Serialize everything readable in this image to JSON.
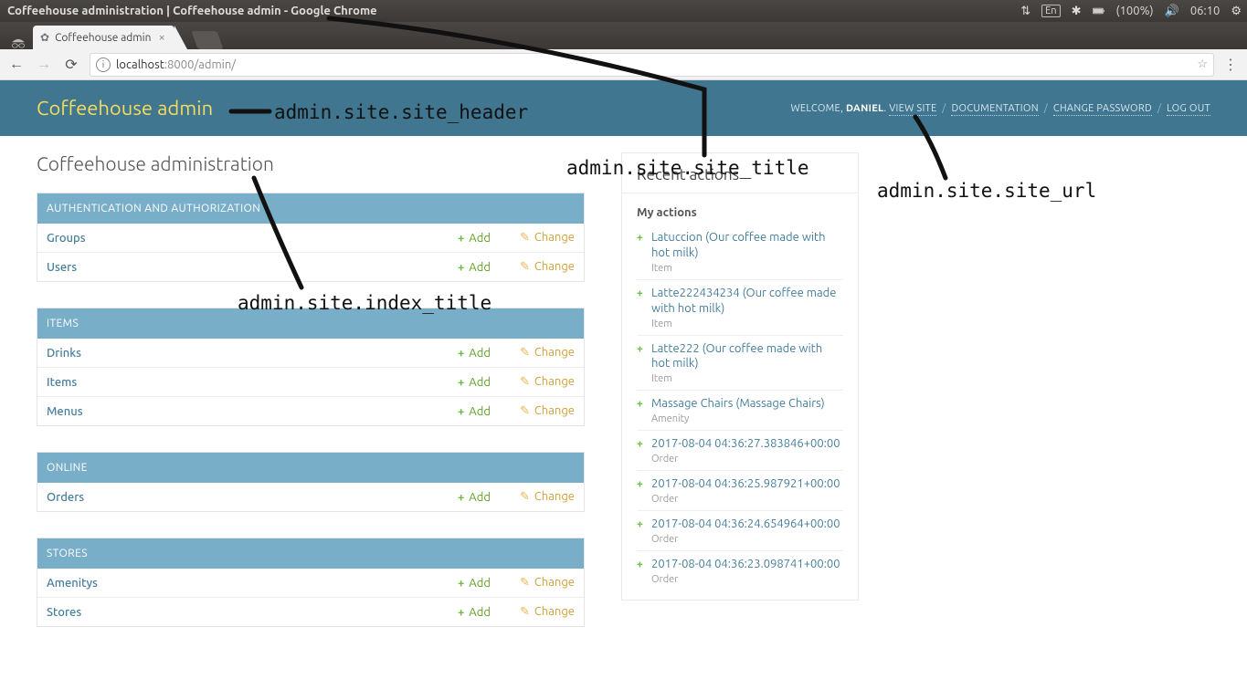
{
  "os": {
    "window_title": "Coffeehouse administration | Coffeehouse admin - Google Chrome",
    "lang": "En",
    "battery": "(100%)",
    "clock": "06:10"
  },
  "browser": {
    "tab_title": "Coffeehouse admin",
    "url_host": "localhost",
    "url_port": ":8000",
    "url_path": "/admin/"
  },
  "header": {
    "brand": "Coffeehouse admin",
    "welcome": "WELCOME,",
    "user": "DANIEL",
    "view_site": "VIEW SITE",
    "documentation": "DOCUMENTATION",
    "change_password": "CHANGE PASSWORD",
    "log_out": "LOG OUT"
  },
  "index_title": "Coffeehouse administration",
  "add_label": "Add",
  "change_label": "Change",
  "apps": [
    {
      "name": "AUTHENTICATION AND AUTHORIZATION",
      "models": [
        {
          "name": "Groups"
        },
        {
          "name": "Users"
        }
      ]
    },
    {
      "name": "ITEMS",
      "models": [
        {
          "name": "Drinks"
        },
        {
          "name": "Items"
        },
        {
          "name": "Menus"
        }
      ]
    },
    {
      "name": "ONLINE",
      "models": [
        {
          "name": "Orders"
        }
      ]
    },
    {
      "name": "STORES",
      "models": [
        {
          "name": "Amenitys"
        },
        {
          "name": "Stores"
        }
      ]
    }
  ],
  "recent": {
    "title": "Recent actions",
    "my_actions": "My actions",
    "items": [
      {
        "action": "add",
        "label": "Latuccion (Our coffee made with hot milk)",
        "type": "Item"
      },
      {
        "action": "add",
        "label": "Latte222434234 (Our coffee made with hot milk)",
        "type": "Item"
      },
      {
        "action": "add",
        "label": "Latte222 (Our coffee made with hot milk)",
        "type": "Item"
      },
      {
        "action": "add",
        "label": "Massage Chairs (Massage Chairs)",
        "type": "Amenity"
      },
      {
        "action": "add",
        "label": "2017-08-04 04:36:27.383846+00:00",
        "type": "Order"
      },
      {
        "action": "add",
        "label": "2017-08-04 04:36:25.987921+00:00",
        "type": "Order"
      },
      {
        "action": "add",
        "label": "2017-08-04 04:36:24.654964+00:00",
        "type": "Order"
      },
      {
        "action": "add",
        "label": "2017-08-04 04:36:23.098741+00:00",
        "type": "Order"
      }
    ]
  },
  "annotations": {
    "site_header": "admin.site.site_header",
    "site_title": "admin.site.site_title",
    "index_title": "admin.site.index_title",
    "site_url": "admin.site.site_url"
  }
}
